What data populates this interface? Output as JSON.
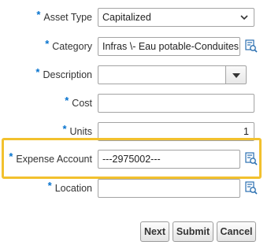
{
  "form": {
    "required_marker": "*",
    "asset_type": {
      "label": "Asset Type",
      "value": "Capitalized"
    },
    "category": {
      "label": "Category",
      "value": "Infras \\- Eau potable-Conduites"
    },
    "description": {
      "label": "Description",
      "value": ""
    },
    "cost": {
      "label": "Cost",
      "value": ""
    },
    "units": {
      "label": "Units",
      "value": "1"
    },
    "expense_account": {
      "label": "Expense Account",
      "value": "---2975002---"
    },
    "location": {
      "label": "Location",
      "value": ""
    }
  },
  "buttons": {
    "next": "Next",
    "submit": "Submit",
    "cancel": "Cancel"
  },
  "colors": {
    "required_star": "#0572ce",
    "highlight_border": "#f2c12e",
    "search_icon": "#2a6fb0"
  },
  "icons": [
    "chevron-down-icon",
    "search-list-icon",
    "dropdown-triangle-icon"
  ]
}
